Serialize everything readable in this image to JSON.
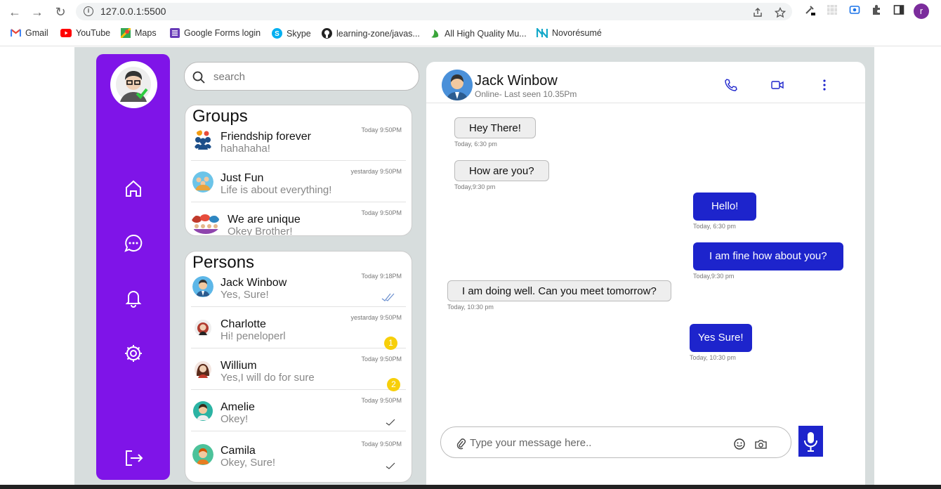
{
  "browser": {
    "url": "127.0.0.1:5500",
    "profile_initial": "r",
    "bookmarks": [
      {
        "label": "Gmail",
        "icon": "gmail-icon",
        "color": "#ea4335"
      },
      {
        "label": "YouTube",
        "icon": "youtube-icon",
        "color": "#ff0000"
      },
      {
        "label": "Maps",
        "icon": "maps-icon",
        "color": "#34a853"
      },
      {
        "label": "Google Forms login",
        "icon": "forms-icon",
        "color": "#673ab7"
      },
      {
        "label": "Skype",
        "icon": "skype-icon",
        "color": "#00aff0"
      },
      {
        "label": "learning-zone/javas...",
        "icon": "github-icon",
        "color": "#222222"
      },
      {
        "label": "All High Quality Mu...",
        "icon": "music-icon",
        "color": "#3aa53a"
      },
      {
        "label": "Novorésumé",
        "icon": "novoresume-icon",
        "color": "#12a8c9"
      }
    ]
  },
  "search": {
    "placeholder": "search"
  },
  "groups": {
    "title": "Groups",
    "items": [
      {
        "name": "Friendship forever",
        "message": "hahahaha!",
        "time": "Today 9:50PM"
      },
      {
        "name": "Just Fun",
        "message": "Life is about everything!",
        "time": "yestarday 9:50PM"
      },
      {
        "name": "We are unique",
        "message": "Okey Brother!",
        "time": "Today 9:50PM"
      }
    ]
  },
  "persons": {
    "title": "Persons",
    "items": [
      {
        "name": "Jack Winbow",
        "message": "Yes, Sure!",
        "time": "Today 9:18PM",
        "status": "read"
      },
      {
        "name": "Charlotte",
        "message": "Hi! peneloperl",
        "time": "yestarday 9:50PM",
        "unread": "1"
      },
      {
        "name": "Willium",
        "message": "Yes,I will do for sure",
        "time": "Today 9:50PM",
        "unread": "2"
      },
      {
        "name": "Amelie",
        "message": "Okey!",
        "time": "Today 9:50PM",
        "status": "sent"
      },
      {
        "name": "Camila",
        "message": "Okey, Sure!",
        "time": "Today 9:50PM",
        "status": "sent"
      }
    ]
  },
  "chat": {
    "name": "Jack Winbow",
    "status": "Online- Last seen 10.35Pm",
    "messages": [
      {
        "text": "Hey There!",
        "time": "Today, 6:30 pm",
        "side": "in"
      },
      {
        "text": "How are you?",
        "time": "Today,9:30 pm",
        "side": "in"
      },
      {
        "text": "Hello!",
        "time": "Today, 6:30 pm",
        "side": "out"
      },
      {
        "text": "I am fine how about you?",
        "time": "Today,9:30 pm",
        "side": "out"
      },
      {
        "text": "I am doing well. Can you meet tomorrow?",
        "time": "Today, 10:30 pm",
        "side": "in"
      },
      {
        "text": "Yes Sure!",
        "time": "Today, 10:30 pm",
        "side": "out"
      }
    ],
    "compose_placeholder": "Type your message here.."
  },
  "colors": {
    "sidebar": "#7f14e8",
    "accent": "#1d24cc",
    "badge": "#f7cf0a",
    "page_bg": "#d7dddd"
  }
}
